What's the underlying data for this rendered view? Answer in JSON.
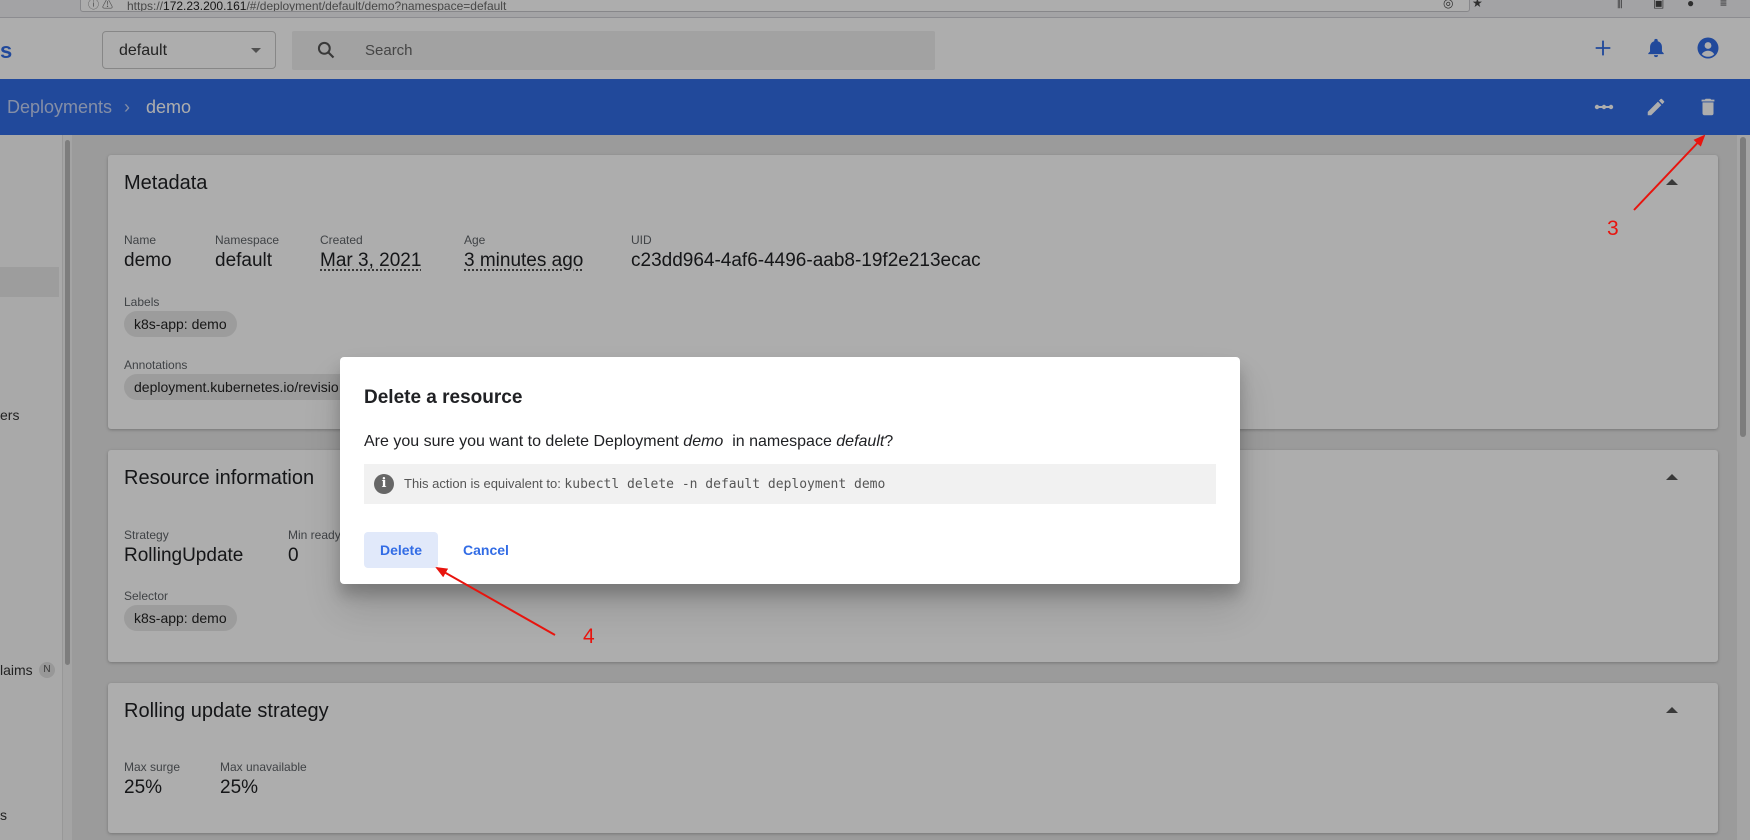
{
  "browser": {
    "url_prefix": "https://",
    "url_host": "172.23.200.161",
    "url_path": "/#/deployment/default/demo?namespace=default"
  },
  "topbar": {
    "brand_fragment": "s",
    "namespace": "default",
    "search_placeholder": "Search"
  },
  "breadcrumb": {
    "parent": "Deployments",
    "separator": "›",
    "current": "demo"
  },
  "sidenav": {
    "fragments": [
      "ers",
      "laims",
      "s"
    ],
    "badge": "N"
  },
  "metadata": {
    "title": "Metadata",
    "fields": [
      {
        "label": "Name",
        "value": "demo"
      },
      {
        "label": "Namespace",
        "value": "default"
      },
      {
        "label": "Created",
        "value": "Mar 3, 2021"
      },
      {
        "label": "Age",
        "value": "3 minutes ago"
      },
      {
        "label": "UID",
        "value": "c23dd964-4af6-4496-aab8-19f2e213ecac"
      }
    ],
    "labels_title": "Labels",
    "labels": [
      "k8s-app: demo"
    ],
    "annotations_title": "Annotations",
    "annotations": [
      "deployment.kubernetes.io/revisio"
    ]
  },
  "resource_info": {
    "title": "Resource information",
    "fields": [
      {
        "label": "Strategy",
        "value": "RollingUpdate"
      },
      {
        "label": "Min ready",
        "value": "0"
      }
    ],
    "selector_title": "Selector",
    "selector": [
      "k8s-app: demo"
    ]
  },
  "rolling_update": {
    "title": "Rolling update strategy",
    "fields": [
      {
        "label": "Max surge",
        "value": "25%"
      },
      {
        "label": "Max unavailable",
        "value": "25%"
      }
    ]
  },
  "dialog": {
    "title": "Delete a resource",
    "message_prefix": "Are you sure you want to delete Deployment ",
    "resource_name": "demo",
    "message_middle": "  in namespace ",
    "namespace": "default",
    "message_suffix": "?",
    "info_text": "This action is equivalent to: ",
    "info_command": "kubectl delete -n default deployment demo",
    "delete_label": "Delete",
    "cancel_label": "Cancel"
  },
  "annotations_overlay": {
    "step_a": "3",
    "step_b": "4",
    "color": "#e8140e"
  },
  "colors": {
    "primary": "#326ce5",
    "scrim": "rgba(0,0,0,0.32)"
  }
}
